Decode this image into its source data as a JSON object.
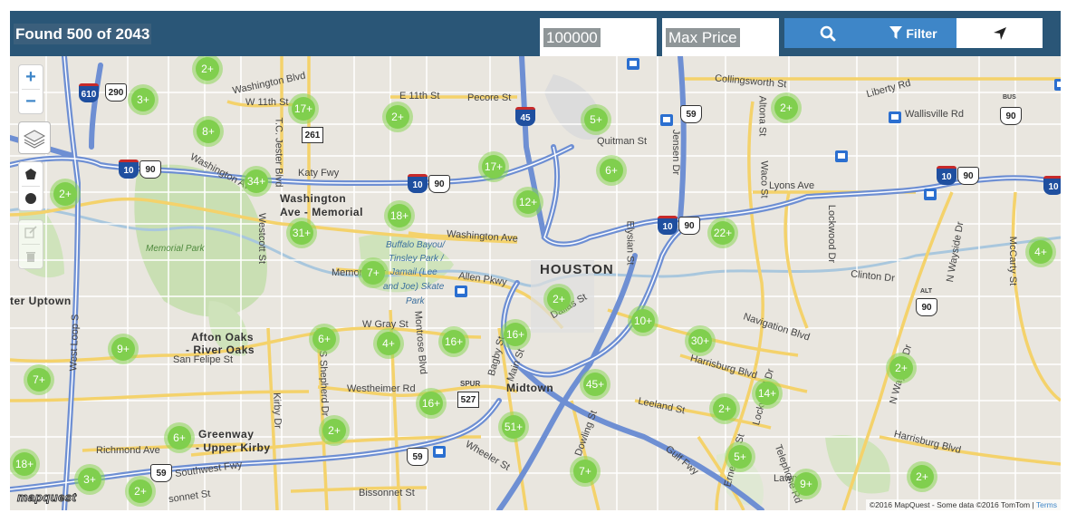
{
  "header": {
    "results_text": "Found 500 of 2043",
    "min_price_value": "100000",
    "max_price_placeholder": "Max Price",
    "filter_label": "Filter"
  },
  "map_controls": {
    "zoom_in": "+",
    "zoom_out": "−"
  },
  "clusters": [
    "2+",
    "3+",
    "17+",
    "2+",
    "5+",
    "2+",
    "8+",
    "34+",
    "17+",
    "6+",
    "2+",
    "12+",
    "18+",
    "31+",
    "22+",
    "4+",
    "7+",
    "2+",
    "10+",
    "6+",
    "4+",
    "16+",
    "16+",
    "30+",
    "9+",
    "7+",
    "45+",
    "2+",
    "14+",
    "16+",
    "2+",
    "2+",
    "51+",
    "6+",
    "5+",
    "18+",
    "3+",
    "2+",
    "7+",
    "9+",
    "2+"
  ],
  "labels": {
    "pierce_elevated": "W 11th St",
    "e11th": "E 11th St",
    "pecore": "Pecore St",
    "collingsworth": "Collingsworth St",
    "liberty": "Liberty Rd",
    "wallisville": "Wallisville Rd",
    "quitman": "Quitman St",
    "katy_fwy": "Katy Fwy",
    "washington_ave": "Washington Ave",
    "washington_area": "Washington",
    "memorial_area": "Ave - Memorial",
    "memorial_park": "Memorial Park",
    "buffalo_park_1": "Buffalo Bayou/",
    "buffalo_park_2": "Tinsley Park /",
    "buffalo_park_3": "Jamail (Lee",
    "buffalo_park_4": "and Joe) Skate",
    "buffalo_park_5": "Park",
    "memorial_dr": "Memorial Dr",
    "allen_pkwy": "Allen Pkwy",
    "houston": "HOUSTON",
    "lyons": "Lyons Ave",
    "clinton": "Clinton Dr",
    "navigation": "Navigation Blvd",
    "harrisburg": "Harrisburg Blvd",
    "harrisburg2": "Harrisburg Blvd",
    "uptown": "ter Uptown",
    "afton_1": "Afton Oaks",
    "afton_2": "- River Oaks",
    "san_felipe": "San Felipe St",
    "w_gray": "W Gray St",
    "westheimer": "Westheimer Rd",
    "midtown": "Midtown",
    "leeland": "Leeland St",
    "greenway_1": "Greenway",
    "greenway_2": "- Upper Kirby",
    "richmond": "Richmond Ave",
    "southwest_fwy": "Southwest Fwy",
    "bissonnet": "Bissonnet St",
    "wheeler": "Wheeler St",
    "dallas": "Dallas St",
    "gulf_fwy": "Gulf Fwy",
    "lockwood": "Lockwood Dr",
    "wayside": "N Wayside Dr",
    "mccarty": "McCarty St",
    "altona": "Altona St",
    "waco": "Waco St",
    "jensen": "Jensen Dr",
    "elysian": "Elysian St",
    "tc_jester": "T.C. Jester Blvd",
    "westcott": "Westcott St",
    "west_loop": "West Loop S",
    "shepherd": "S Shepherd Dr",
    "montrose": "Montrose Blvd",
    "kirby": "Kirby Dr",
    "main": "Main St",
    "bagby": "Bagby St",
    "dowling": "Dowling St",
    "ernestine": "Ernestine St",
    "telephone": "Telephone Rd",
    "lawn": "Lawn",
    "washington_blvd": "Washington Blvd",
    "sonnet": "sonnet St",
    "spur": "SPUR"
  },
  "shields": {
    "i610": "610",
    "us290": "290",
    "st261": "261",
    "i45": "45",
    "us59a": "59",
    "busus90": "90",
    "i10a": "10",
    "us90a": "90",
    "i10b": "10",
    "us90b": "90",
    "i10c": "10",
    "us90c": "90",
    "i10d": "10",
    "us90d": "90",
    "alt90": "90",
    "spur527": "527",
    "us59b": "59",
    "us59c": "59",
    "i10e": "10",
    "bus_label": "BUS",
    "alt_label": "ALT"
  },
  "footer": {
    "logo": "mapquest",
    "attribution": "©2016 MapQuest  -  Some data ©2016 TomTom | ",
    "terms": "Terms"
  },
  "colors": {
    "header_bg": "#2a5677",
    "button_blue": "#3e86c8",
    "cluster_green": "#80cf4e",
    "highway": "#6e8fd3"
  }
}
